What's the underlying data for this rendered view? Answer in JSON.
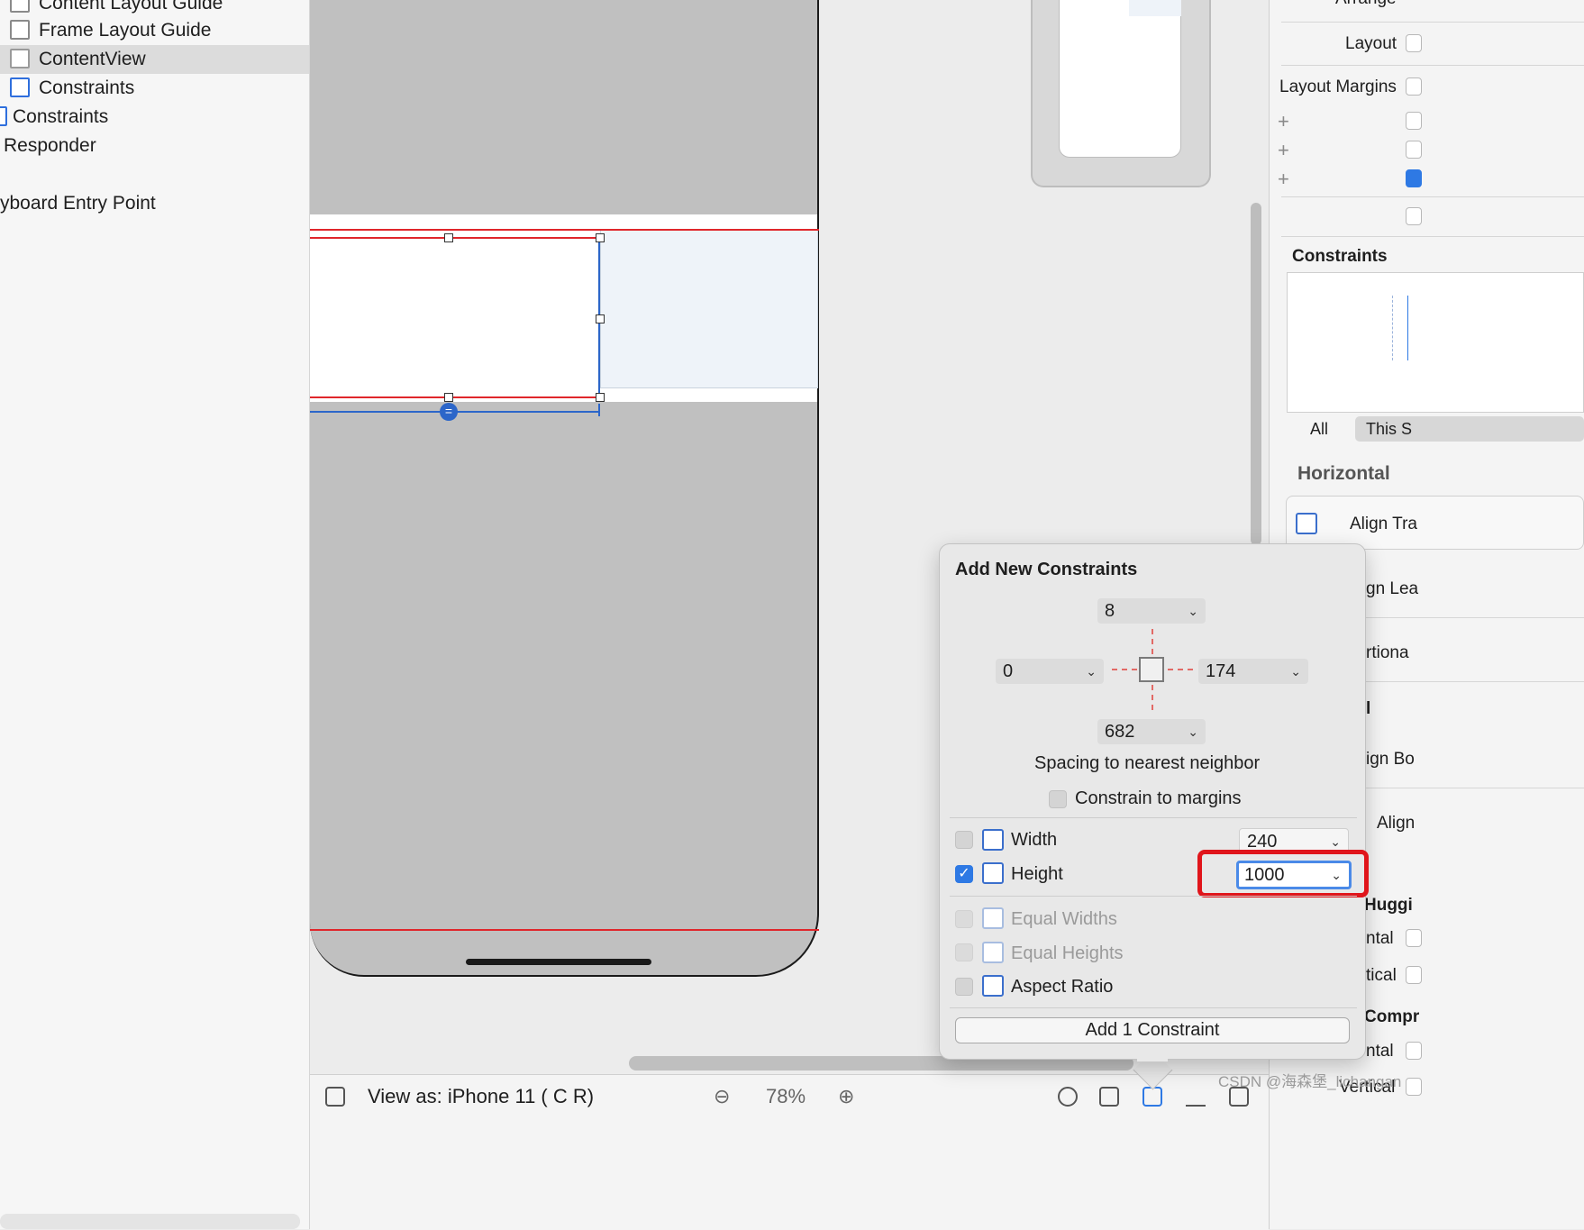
{
  "outline": {
    "items": [
      {
        "label": "Content Layout Guide"
      },
      {
        "label": "Frame Layout Guide"
      },
      {
        "label": "ContentView"
      },
      {
        "label": "Constraints"
      },
      {
        "label": "Constraints"
      },
      {
        "label": "Responder"
      },
      {
        "label": "yboard Entry Point"
      }
    ],
    "selected": "ContentView"
  },
  "canvas": {
    "eq_symbol": "="
  },
  "bottombar": {
    "view_as": "View as: iPhone 11 (  C   R)",
    "zoom": "78%",
    "zoom_out": "⊖",
    "zoom_in": "⊕"
  },
  "inspector": {
    "arrange": "Arrange",
    "layout": "Layout",
    "layout_margins": "Layout Margins",
    "plus": "+",
    "constraints_title": "Constraints",
    "seg_all": "All",
    "seg_this": "This S",
    "horizontal": "Horizontal",
    "align_tra": "Align Tra",
    "gn_lea": "gn Lea",
    "rtiona": "rtiona",
    "l_frag": "l",
    "ign_bo": "ign Bo",
    "align_frag": "Align",
    "huggi": "Huggi",
    "ntal_1": "ntal",
    "tical_1": "tical",
    "compr": "Compr",
    "ntal_2": "ntal",
    "vertical": "Vertical"
  },
  "popover": {
    "title": "Add New Constraints",
    "top": "8",
    "left": "0",
    "right": "174",
    "bottom": "682",
    "spacing_label": "Spacing to nearest neighbor",
    "constrain_margins": "Constrain to margins",
    "width_label": "Width",
    "width_value": "240",
    "height_label": "Height",
    "height_value": "1000",
    "height_checked": true,
    "equal_widths": "Equal Widths",
    "equal_heights": "Equal Heights",
    "aspect_ratio": "Aspect Ratio",
    "add_button": "Add 1 Constraint",
    "checkmark": "✓",
    "chevron": "⌄"
  },
  "watermark": "CSDN @海森堡_lichangan",
  "colors": {
    "accent": "#2e79e4",
    "selection_blue": "#2c66c9",
    "constraint_red": "#e0262b",
    "highlight_red": "#e0151b"
  }
}
